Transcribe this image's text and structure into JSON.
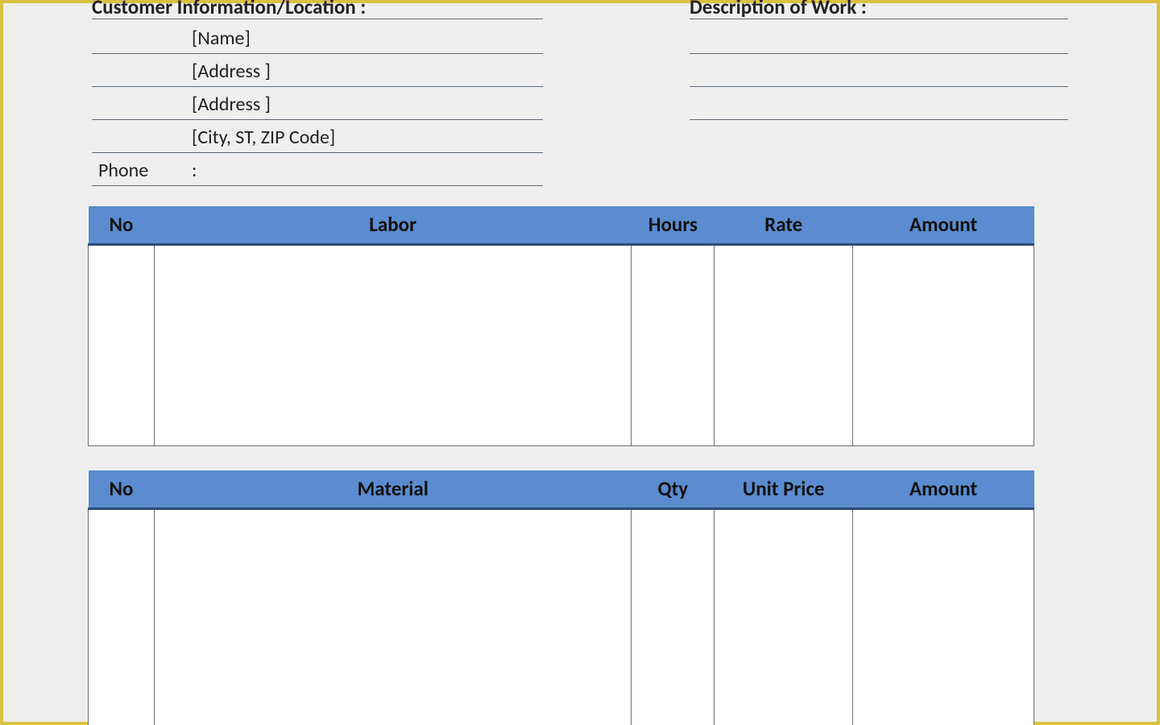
{
  "customer": {
    "heading": "Customer Information/Location :",
    "name": "[Name]",
    "address1": "[Address ]",
    "address2": "[Address ]",
    "city_st_zip": "[City, ST, ZIP Code]",
    "phone_label": "Phone",
    "phone_colon": ":"
  },
  "work": {
    "heading": "Description of Work :"
  },
  "labor": {
    "headers": {
      "no": "No",
      "desc": "Labor",
      "col_a": "Hours",
      "col_b": "Rate",
      "amount": "Amount"
    }
  },
  "material": {
    "headers": {
      "no": "No",
      "desc": "Material",
      "col_a": "Qty",
      "col_b": "Unit Price",
      "amount": "Amount"
    }
  },
  "colors": {
    "header_bg": "#5a8ccf",
    "header_underline": "#2b4a74",
    "grid_line": "#6f6f6f",
    "frame_border": "#d9c142",
    "page_bg": "#efefef"
  }
}
